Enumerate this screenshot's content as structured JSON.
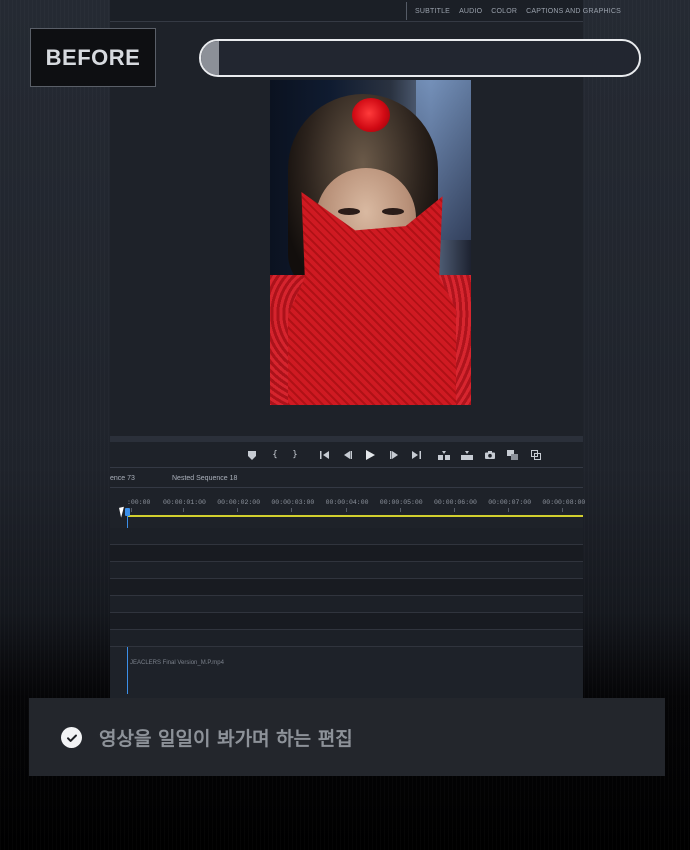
{
  "badge": {
    "label": "BEFORE"
  },
  "progress": {
    "value_percent": 4
  },
  "workspace_tabs": [
    "SUBTITLE",
    "AUDIO",
    "COLOR",
    "CAPTIONS AND GRAPHICS"
  ],
  "transport_icons": [
    "marker-icon",
    "mark-in-icon",
    "mark-out-icon",
    "go-to-in-icon",
    "step-back-icon",
    "play-icon",
    "step-forward-icon",
    "go-to-out-icon",
    "insert-icon",
    "overwrite-icon",
    "export-frame-icon",
    "comparison-view-icon",
    "multi-camera-icon"
  ],
  "sequence_tabs": [
    "ence 73",
    "Nested Sequence 18"
  ],
  "ruler_labels": [
    ":00:00",
    "00:00:01:00",
    "00:00:02:00",
    "00:00:03:00",
    "00:00:04:00",
    "00:00:05:00",
    "00:00:06:00",
    "00:00:07:00",
    "00:00:08:00"
  ],
  "clip_label": "JEACLERS  Final Version_M.P.mp4",
  "caption": {
    "text": "영상을 일일이 봐가며 하는 편집"
  },
  "colors": {
    "work_area": "#d2cf2e",
    "playhead": "#3c8fe8",
    "video_accent": "#cf1a22"
  }
}
